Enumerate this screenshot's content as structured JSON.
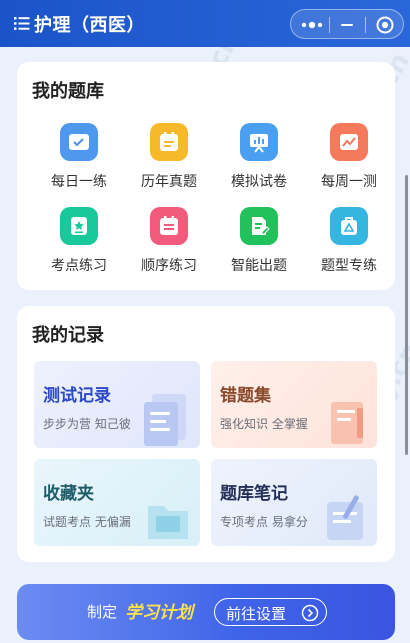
{
  "header": {
    "title": "护理（西医）",
    "menu_icon": "list-icon",
    "capsule": {
      "more_icon": "more-dots-icon",
      "minimize_icon": "minimize-icon",
      "close_icon": "target-circle-icon"
    }
  },
  "question_bank": {
    "title": "我的题库",
    "items": [
      {
        "label": "每日一练",
        "icon": "check-list-icon",
        "color": "#4e98ee"
      },
      {
        "label": "历年真题",
        "icon": "calendar-doc-icon",
        "color": "#f7b82a"
      },
      {
        "label": "模拟试卷",
        "icon": "chart-board-icon",
        "color": "#4a9ff0"
      },
      {
        "label": "每周一测",
        "icon": "image-chart-icon",
        "color": "#f5795b"
      },
      {
        "label": "考点练习",
        "icon": "star-doc-icon",
        "color": "#19c89b"
      },
      {
        "label": "顺序练习",
        "icon": "calendar-list-icon",
        "color": "#f25b7c"
      },
      {
        "label": "智能出题",
        "icon": "pen-doc-icon",
        "color": "#21c15b"
      },
      {
        "label": "题型专练",
        "icon": "warning-bag-icon",
        "color": "#34b6e0"
      }
    ]
  },
  "records": {
    "title": "我的记录",
    "items": [
      {
        "title": "测试记录",
        "subtitle": "步步为营 知己彼",
        "title_color": "#2b48c8",
        "bg": "#e7ecfb"
      },
      {
        "title": "错题集",
        "subtitle": "强化知识 全掌握",
        "title_color": "#8a4a2a",
        "bg": "#fde9e2"
      },
      {
        "title": "收藏夹",
        "subtitle": "试题考点 无偏漏",
        "title_color": "#1f5c6a",
        "bg": "#e2f3fa"
      },
      {
        "title": "题库笔记",
        "subtitle": "专项考点 易拿分",
        "title_color": "#24305a",
        "bg": "#e9effb"
      }
    ]
  },
  "plan_banner": {
    "prefix": "制定",
    "highlight": "学习计划",
    "button_label": "前往设置",
    "button_icon": "chevron-right-circle-icon"
  }
}
